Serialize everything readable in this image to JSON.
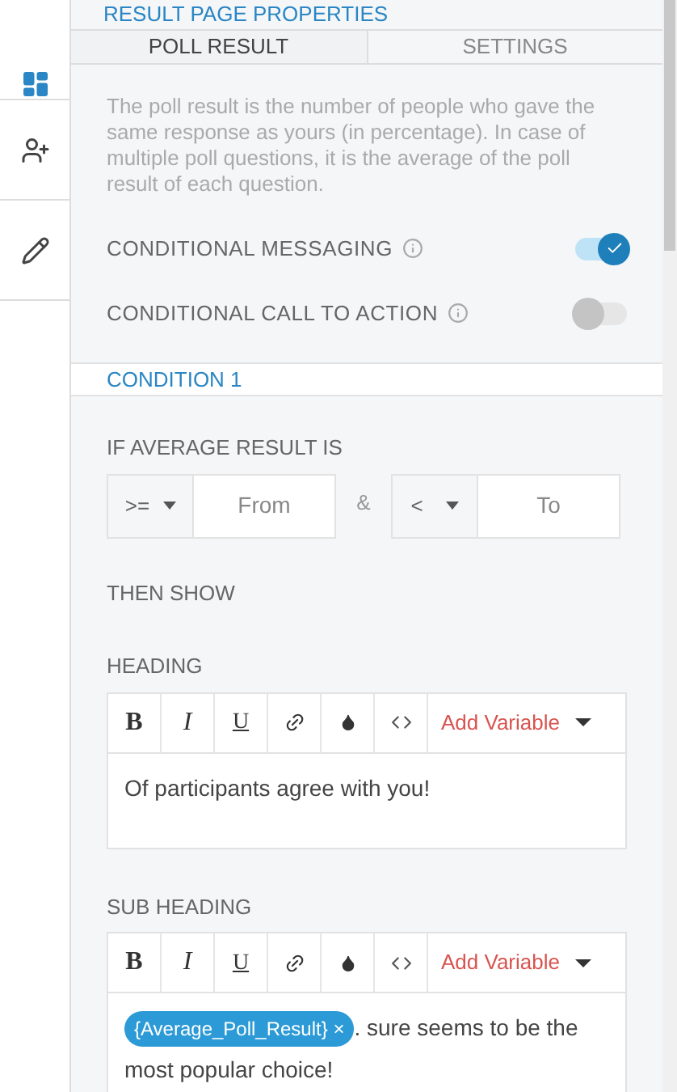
{
  "sidebar": {
    "items": [
      {
        "kind": "layout",
        "selected": true
      },
      {
        "kind": "add-user",
        "selected": false
      },
      {
        "kind": "edit",
        "selected": false
      }
    ]
  },
  "panel": {
    "title": "RESULT PAGE PROPERTIES",
    "tabs": [
      {
        "label": "POLL RESULT",
        "selected": true
      },
      {
        "label": "SETTINGS",
        "selected": false
      }
    ],
    "description": "The poll result is the number of people who gave the same response as yours (in percentage). In case of multiple poll questions, it is the average of the poll result of each question.",
    "toggles": [
      {
        "label": "CONDITIONAL MESSAGING",
        "on": true
      },
      {
        "label": "CONDITIONAL CALL TO ACTION",
        "on": false
      }
    ],
    "condition": {
      "title": "CONDITION 1",
      "range_label": "IF AVERAGE RESULT IS",
      "from_operator": ">=",
      "from_placeholder": "From",
      "joiner": "&",
      "to_operator": "<",
      "to_placeholder": "To",
      "then_label": "THEN SHOW",
      "editors": [
        {
          "label": "HEADING",
          "toolbar": [
            {
              "kind": "bold",
              "label": "B"
            },
            {
              "kind": "italic",
              "label": "I"
            },
            {
              "kind": "underline",
              "label": "U"
            },
            {
              "kind": "link"
            },
            {
              "kind": "color"
            },
            {
              "kind": "code"
            }
          ],
          "add_variable": "Add Variable",
          "text": "Of participants agree with you!"
        },
        {
          "label": "SUB HEADING",
          "toolbar": [
            {
              "kind": "bold",
              "label": "B"
            },
            {
              "kind": "italic",
              "label": "I"
            },
            {
              "kind": "underline",
              "label": "U"
            },
            {
              "kind": "link"
            },
            {
              "kind": "color"
            },
            {
              "kind": "code"
            }
          ],
          "add_variable": "Add Variable",
          "variable": "{Average_Poll_Result}",
          "variable_remove": "×",
          "text": ". sure seems to be the most popular choice!"
        }
      ]
    }
  }
}
